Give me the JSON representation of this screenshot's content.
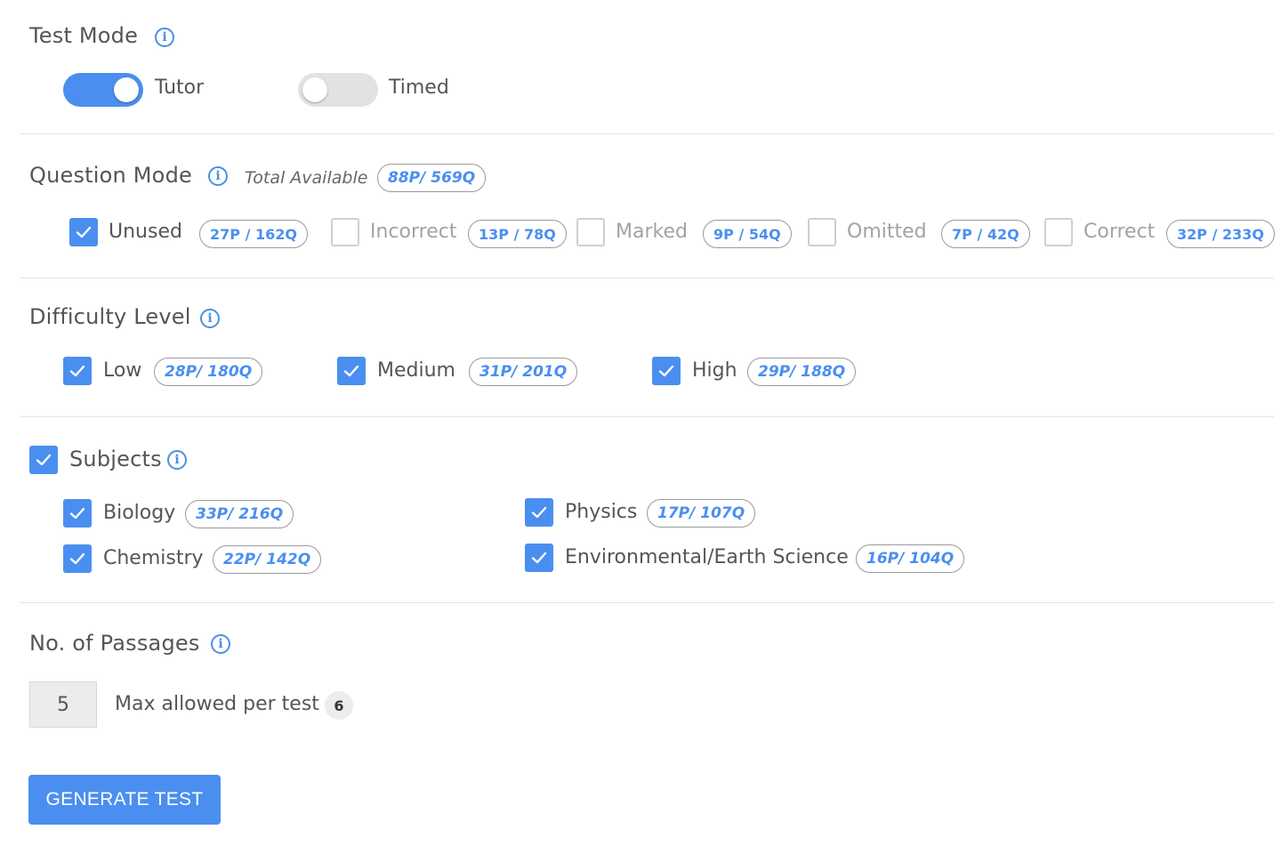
{
  "test_mode": {
    "title": "Test Mode",
    "tutor_label": "Tutor",
    "timed_label": "Timed",
    "tutor_on": true,
    "timed_on": false
  },
  "question_mode": {
    "title": "Question Mode",
    "total_label": "Total Available",
    "total_badge": "88P/ 569Q",
    "items": [
      {
        "label": "Unused",
        "badge": "27P / 162Q",
        "checked": true
      },
      {
        "label": "Incorrect",
        "badge": "13P / 78Q",
        "checked": false
      },
      {
        "label": "Marked",
        "badge": "9P / 54Q",
        "checked": false
      },
      {
        "label": "Omitted",
        "badge": "7P / 42Q",
        "checked": false
      },
      {
        "label": "Correct",
        "badge": "32P / 233Q",
        "checked": false
      }
    ]
  },
  "difficulty": {
    "title": "Difficulty Level",
    "items": [
      {
        "label": "Low",
        "badge": "28P/ 180Q",
        "checked": true
      },
      {
        "label": "Medium",
        "badge": "31P/ 201Q",
        "checked": true
      },
      {
        "label": "High",
        "badge": "29P/ 188Q",
        "checked": true
      }
    ]
  },
  "subjects": {
    "title": "Subjects",
    "checked": true,
    "items": [
      {
        "label": "Biology",
        "badge": "33P/ 216Q",
        "checked": true
      },
      {
        "label": "Physics",
        "badge": "17P/ 107Q",
        "checked": true
      },
      {
        "label": "Chemistry",
        "badge": "22P/ 142Q",
        "checked": true
      },
      {
        "label": "Environmental/Earth Science",
        "badge": "16P/ 104Q",
        "checked": true
      }
    ]
  },
  "passages": {
    "title": "No. of Passages",
    "value": "5",
    "max_label": "Max allowed per test",
    "max_value": "6"
  },
  "generate_button": "GENERATE TEST",
  "colors": {
    "accent": "#4a8ff0",
    "divider": "#e4e4e4",
    "badge_border": "#9a9a9a"
  }
}
